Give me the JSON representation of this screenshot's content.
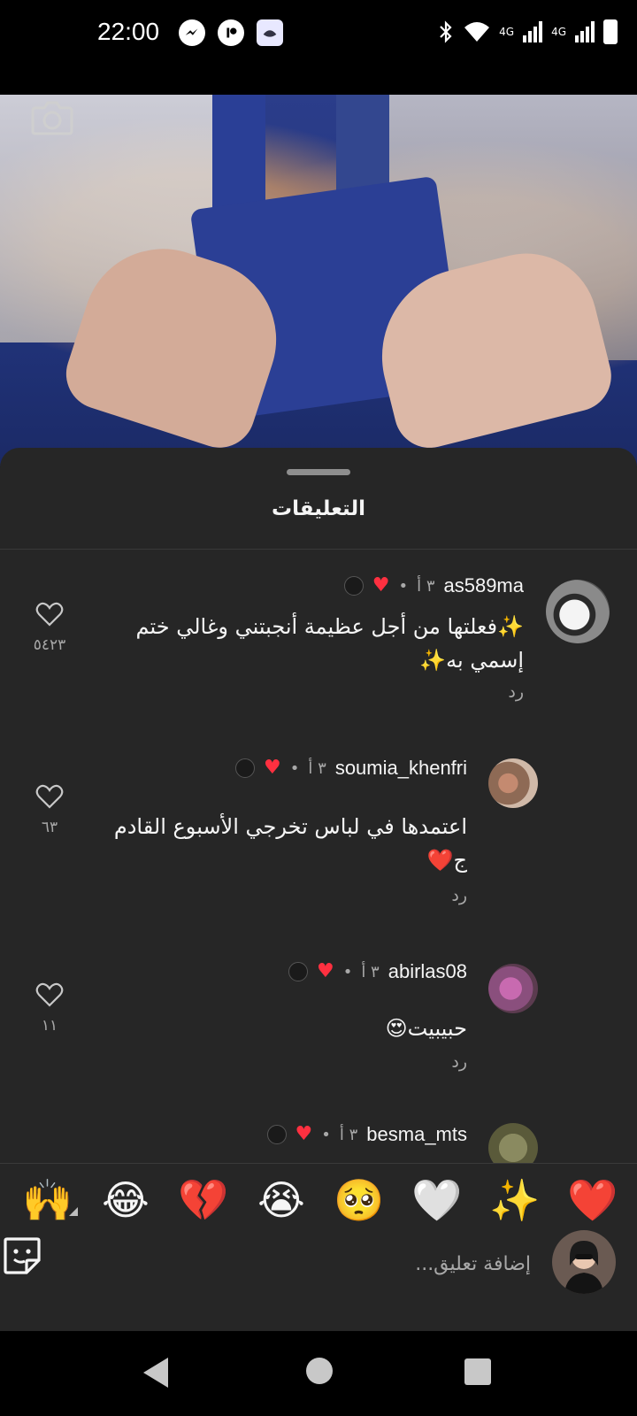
{
  "status_bar": {
    "time": "22:00",
    "network_1": "4G",
    "network_2": "4G",
    "icons": [
      "messenger-icon",
      "app-icon",
      "quran-icon",
      "bluetooth-icon",
      "wifi-icon",
      "signal-icon",
      "battery-icon"
    ]
  },
  "sheet": {
    "title": "التعليقات"
  },
  "comments": [
    {
      "username": "as589ma",
      "time": "٣ أ",
      "text": "✨فعلتها من أجل عظيمة أنجبتني وغالي ختم إسمي به✨",
      "reply_label": "رد",
      "likes": "٥٤٢٣",
      "author_liked": true
    },
    {
      "username": "soumia_khenfri",
      "time": "٣ أ",
      "text": "اعتمدها في لباس تخرجي الأسبوع القادم ج❤️",
      "reply_label": "رد",
      "likes": "٦٣",
      "author_liked": true
    },
    {
      "username": "abirlas08",
      "time": "٣ أ",
      "text": "حبيبيت😍",
      "reply_label": "رد",
      "likes": "١١",
      "author_liked": true
    },
    {
      "username": "besma_mts",
      "time": "٣ أ",
      "text": "",
      "reply_label": "",
      "likes": "",
      "author_liked": true
    }
  ],
  "emoji_bar": [
    "❤️",
    "✨",
    "🤍",
    "🥺",
    "😭",
    "💔",
    "😂",
    "🙌"
  ],
  "composer": {
    "placeholder": "إضافة تعليق..."
  },
  "colors": {
    "sheet_bg": "#262626",
    "like_red": "#ff3040",
    "muted_text": "#a8a8a8"
  }
}
